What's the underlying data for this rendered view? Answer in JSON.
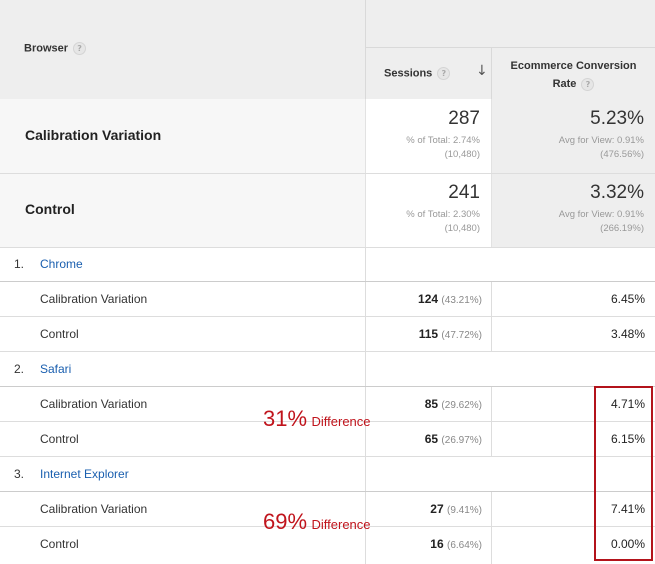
{
  "header": {
    "browser_label": "Browser",
    "sessions_label": "Sessions",
    "conv_label_line1": "Ecommerce Conversion",
    "conv_label_line2": "Rate",
    "help_glyph": "?",
    "sort_glyph": "↓"
  },
  "segments": [
    {
      "name": "Calibration Variation",
      "sessions": "287",
      "sessions_sub1": "% of Total: 2.74%",
      "sessions_sub2": "(10,480)",
      "conv": "5.23%",
      "conv_sub1": "Avg for View: 0.91%",
      "conv_sub2": "(476.56%)"
    },
    {
      "name": "Control",
      "sessions": "241",
      "sessions_sub1": "% of Total: 2.30%",
      "sessions_sub2": "(10,480)",
      "conv": "3.32%",
      "conv_sub1": "Avg for View: 0.91%",
      "conv_sub2": "(266.19%)"
    }
  ],
  "groups": [
    {
      "index": "1.",
      "name": "Chrome",
      "rows": [
        {
          "label": "Calibration Variation",
          "sessions": "124",
          "pct": "(43.21%)",
          "conv": "6.45%"
        },
        {
          "label": "Control",
          "sessions": "115",
          "pct": "(47.72%)",
          "conv": "3.48%"
        }
      ]
    },
    {
      "index": "2.",
      "name": "Safari",
      "rows": [
        {
          "label": "Calibration Variation",
          "sessions": "85",
          "pct": "(29.62%)",
          "conv": "4.71%"
        },
        {
          "label": "Control",
          "sessions": "65",
          "pct": "(26.97%)",
          "conv": "6.15%"
        }
      ]
    },
    {
      "index": "3.",
      "name": "Internet Explorer",
      "rows": [
        {
          "label": "Calibration Variation",
          "sessions": "27",
          "pct": "(9.41%)",
          "conv": "7.41%"
        },
        {
          "label": "Control",
          "sessions": "16",
          "pct": "(6.64%)",
          "conv": "0.00%"
        }
      ]
    }
  ],
  "annotations": [
    {
      "big": "31%",
      "small": "Difference"
    },
    {
      "big": "69%",
      "small": "Difference"
    }
  ],
  "colors": {
    "annotation_red": "#c0141c",
    "link_blue": "#1a5faf",
    "header_gray": "#eeeeee"
  }
}
